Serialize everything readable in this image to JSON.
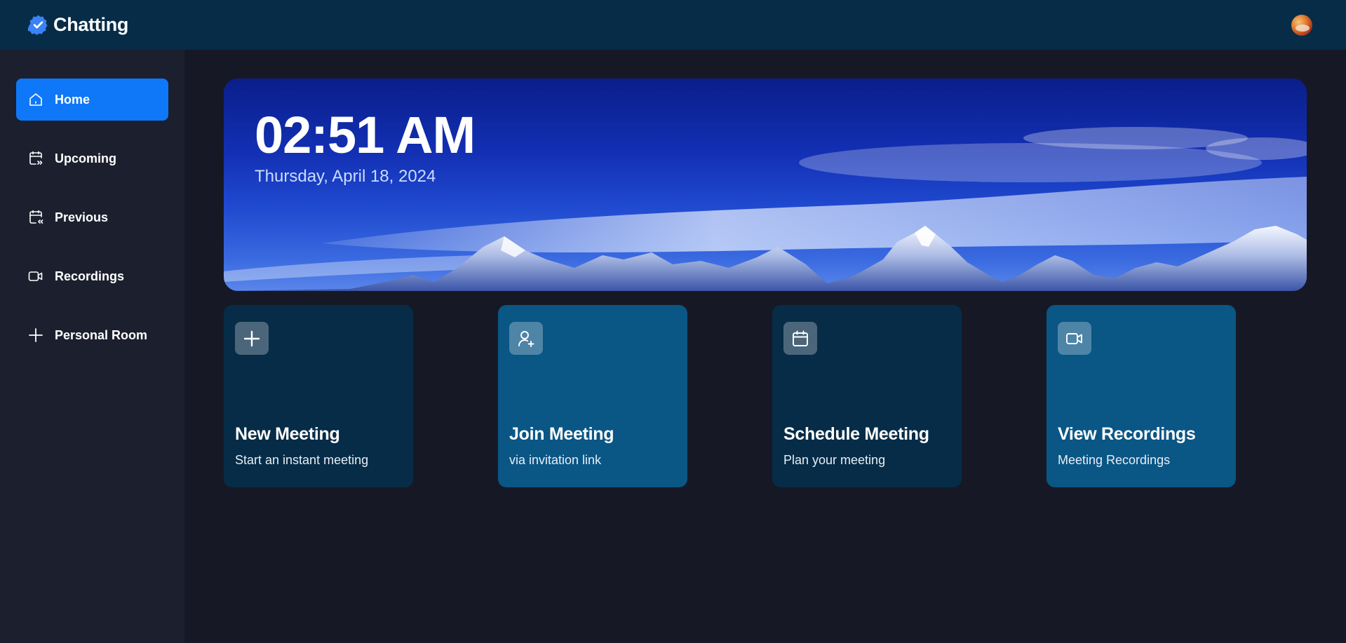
{
  "app": {
    "name": "Chatting",
    "accent": "#0e78f9"
  },
  "header": {
    "logo_icon": "verified-check-icon",
    "avatar_icon": "user-avatar"
  },
  "sidebar": {
    "items": [
      {
        "label": "Home",
        "icon": "home-icon",
        "active": true
      },
      {
        "label": "Upcoming",
        "icon": "calendar-forward-icon",
        "active": false
      },
      {
        "label": "Previous",
        "icon": "calendar-back-icon",
        "active": false
      },
      {
        "label": "Recordings",
        "icon": "video-icon",
        "active": false
      },
      {
        "label": "Personal Room",
        "icon": "plus-icon",
        "active": false
      }
    ]
  },
  "hero": {
    "time": "02:51 AM",
    "date": "Thursday, April 18, 2024"
  },
  "cards": [
    {
      "title": "New Meeting",
      "subtitle": "Start an instant meeting",
      "icon": "plus-icon",
      "color": "#062c47"
    },
    {
      "title": "Join Meeting",
      "subtitle": "via invitation link",
      "icon": "add-user-icon",
      "color": "#0a5685"
    },
    {
      "title": "Schedule Meeting",
      "subtitle": "Plan your meeting",
      "icon": "calendar-icon",
      "color": "#062c47"
    },
    {
      "title": "View Recordings",
      "subtitle": "Meeting Recordings",
      "icon": "video-icon",
      "color": "#0a5685"
    }
  ]
}
